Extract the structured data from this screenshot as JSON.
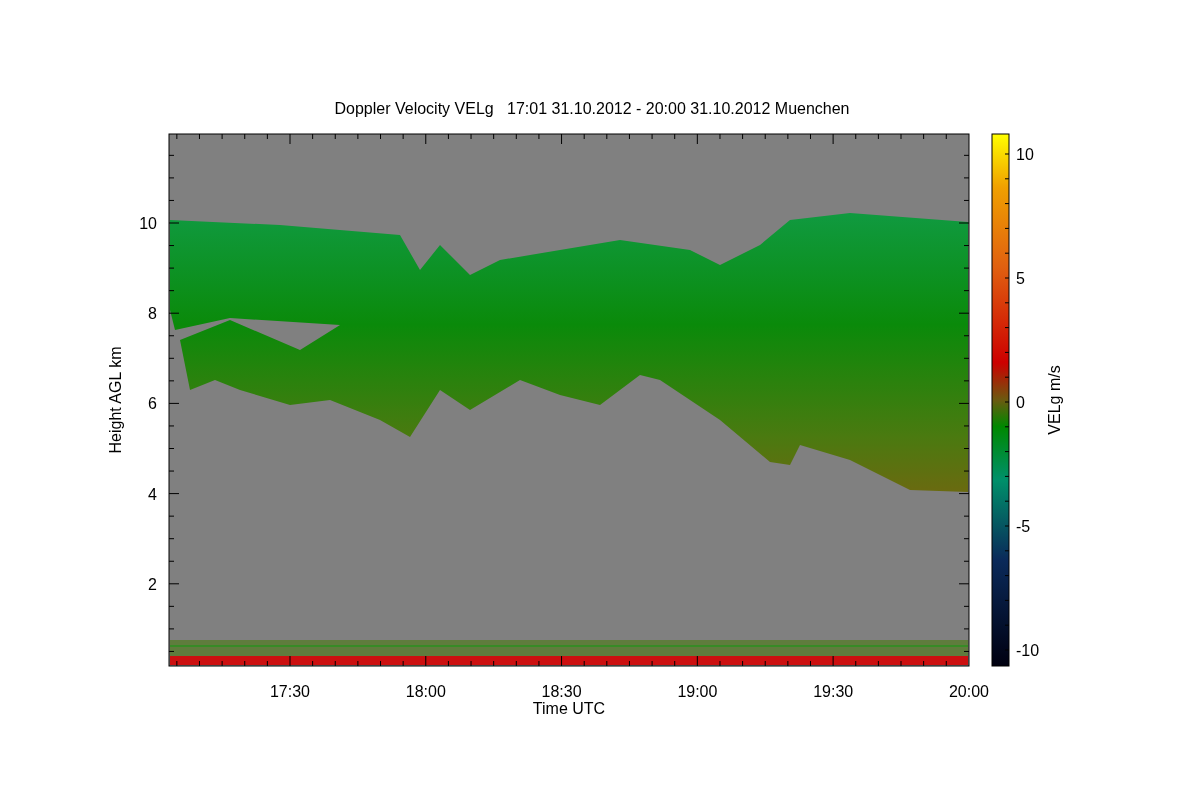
{
  "title": "Doppler Velocity VELg   17:01 31.10.2012 - 20:00 31.10.2012 Muenchen",
  "y_axis": {
    "label": "Height AGL km",
    "tick_labels": [
      "10",
      "8",
      "6",
      "4",
      "2"
    ]
  },
  "x_axis": {
    "label": "Time UTC",
    "tick_labels": [
      "17:30",
      "18:00",
      "18:30",
      "19:00",
      "19:30",
      "20:00"
    ]
  },
  "colorbar": {
    "label": "VELg m/s",
    "tick_labels": [
      "10",
      "5",
      "0",
      "-5",
      "-10"
    ]
  }
}
